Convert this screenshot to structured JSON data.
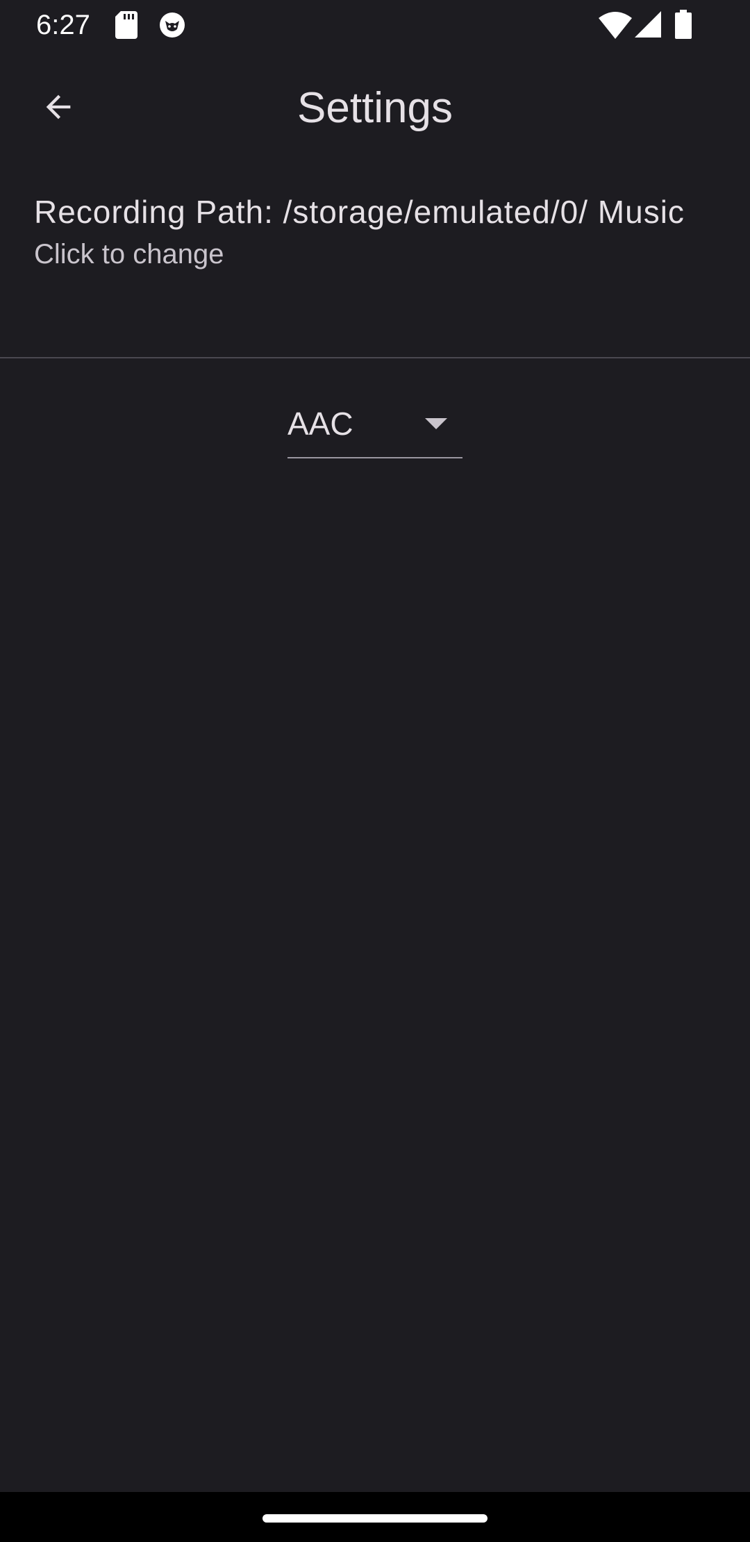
{
  "status_bar": {
    "time": "6:27",
    "icons": [
      "sd-card-icon",
      "cat-icon",
      "wifi-icon",
      "signal-icon",
      "battery-icon"
    ]
  },
  "app_bar": {
    "title": "Settings",
    "back_icon": "arrow-back-icon"
  },
  "recording_path": {
    "title": "Recording Path: /storage/emulated/0/ Music",
    "subtitle": "Click to change"
  },
  "format_dropdown": {
    "selected": "AAC",
    "icon": "arrow-drop-down-icon"
  },
  "colors": {
    "background": "#1d1c21",
    "text_primary": "#e6e1e6",
    "text_secondary": "#c9c4cc",
    "divider": "#4a4850",
    "nav_bar": "#000000"
  }
}
